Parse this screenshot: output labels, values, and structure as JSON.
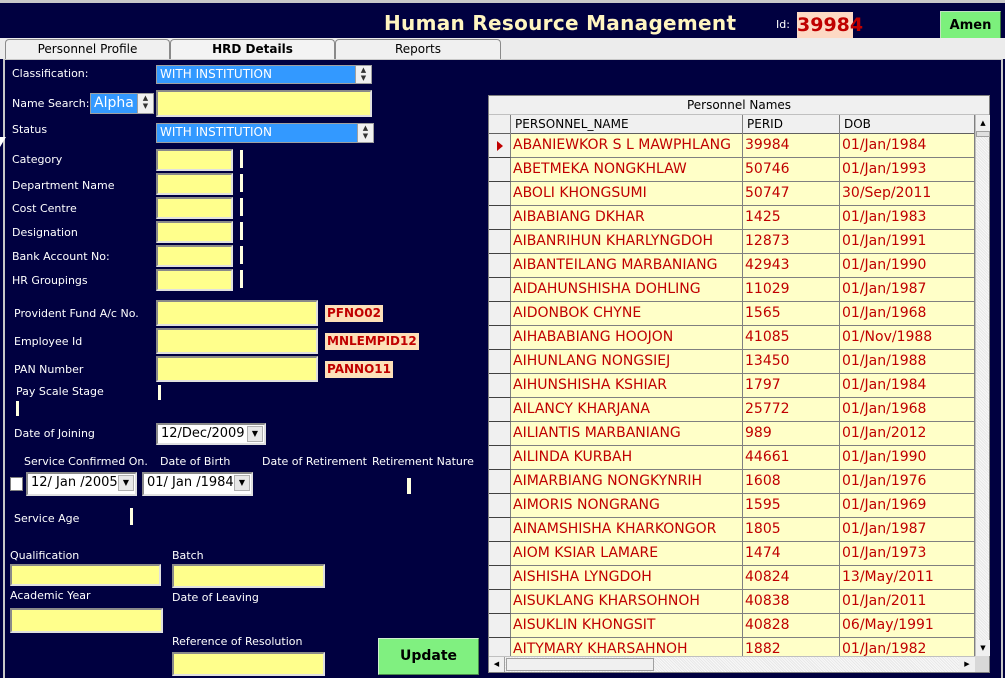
{
  "header": {
    "title": "Human Resource Management",
    "id_label": "Id:",
    "id_value": "39984",
    "user_button": "Amen"
  },
  "tabs": [
    {
      "label": "Personnel Profile",
      "active": false
    },
    {
      "label": "HRD Details",
      "active": true
    },
    {
      "label": "Reports",
      "active": false
    }
  ],
  "form": {
    "classification_label": "Classification:",
    "classification_value": "WITH INSTITUTION",
    "name_search_label": "Name Search:",
    "name_search_mode": "Alpha",
    "name_search_value": "",
    "status_label": "Status",
    "status_value": "WITH INSTITUTION",
    "category_label": "Category",
    "department_label": "Department Name",
    "cost_centre_label": "Cost Centre",
    "designation_label": "Designation",
    "bank_account_label": "Bank Account No:",
    "hr_groupings_label": "HR Groupings",
    "pf_label": "Provident Fund A/c No.",
    "pf_code": "PFNO02",
    "employee_id_label": "Employee Id",
    "employee_id_code": "MNLEMPID12",
    "pan_label": "PAN Number",
    "pan_code": "PANNO11",
    "pay_scale_label": "Pay Scale Stage",
    "doj_label": "Date of Joining",
    "doj_value": "12/Dec/2009",
    "service_confirmed_label": "Service Confirmed On.",
    "service_confirmed_value": "12/ Jan /2005",
    "dob_label": "Date of Birth",
    "dob_value": "01/ Jan /1984",
    "retirement_date_label": "Date of Retirement",
    "retirement_nature_label": "Retirement Nature",
    "service_age_label": "Service Age",
    "qualification_label": "Qualification",
    "batch_label": "Batch",
    "academic_year_label": "Academic Year",
    "date_of_leaving_label": "Date of Leaving",
    "reference_label": "Reference of Resolution",
    "update_button": "Update"
  },
  "grid": {
    "caption": "Personnel Names",
    "columns": [
      "PERSONNEL_NAME",
      "PERID",
      "DOB"
    ],
    "rows": [
      {
        "name": "ABANIEWKOR S L MAWPHLANG",
        "perid": "39984",
        "dob": "01/Jan/1984",
        "current": true
      },
      {
        "name": "ABETMEKA NONGKHLAW",
        "perid": "50746",
        "dob": "01/Jan/1993"
      },
      {
        "name": "ABOLI KHONGSUMI",
        "perid": "50747",
        "dob": "30/Sep/2011"
      },
      {
        "name": "AIBABIANG DKHAR",
        "perid": "1425",
        "dob": "01/Jan/1983"
      },
      {
        "name": "AIBANRIHUN KHARLYNGDOH",
        "perid": "12873",
        "dob": "01/Jan/1991"
      },
      {
        "name": "AIBANTEILANG MARBANIANG",
        "perid": "42943",
        "dob": "01/Jan/1990"
      },
      {
        "name": "AIDAHUNSHISHA DOHLING",
        "perid": "11029",
        "dob": "01/Jan/1987"
      },
      {
        "name": "AIDONBOK CHYNE",
        "perid": "1565",
        "dob": "01/Jan/1968"
      },
      {
        "name": "AIHABABIANG HOOJON",
        "perid": "41085",
        "dob": "01/Nov/1988"
      },
      {
        "name": "AIHUNLANG NONGSIEJ",
        "perid": "13450",
        "dob": "01/Jan/1988"
      },
      {
        "name": "AIHUNSHISHA KSHIAR",
        "perid": "1797",
        "dob": "01/Jan/1984"
      },
      {
        "name": "AILANCY KHARJANA",
        "perid": "25772",
        "dob": "01/Jan/1968"
      },
      {
        "name": "AILIANTIS MARBANIANG",
        "perid": "989",
        "dob": "01/Jan/2012"
      },
      {
        "name": "AILINDA KURBAH",
        "perid": "44661",
        "dob": "01/Jan/1990"
      },
      {
        "name": "AIMARBIANG NONGKYNRIH",
        "perid": "1608",
        "dob": "01/Jan/1976"
      },
      {
        "name": "AIMORIS NONGRANG",
        "perid": "1595",
        "dob": "01/Jan/1969"
      },
      {
        "name": "AINAMSHISHA KHARKONGOR",
        "perid": "1805",
        "dob": "01/Jan/1987"
      },
      {
        "name": "AIOM KSIAR LAMARE",
        "perid": "1474",
        "dob": "01/Jan/1973"
      },
      {
        "name": "AISHISHA LYNGDOH",
        "perid": "40824",
        "dob": "13/May/2011"
      },
      {
        "name": "AISUKLANG KHARSOHNOH",
        "perid": "40838",
        "dob": "01/Jan/2011"
      },
      {
        "name": "AISUKLIN KHONGSIT",
        "perid": "40828",
        "dob": "06/May/1991"
      },
      {
        "name": "AITYMARY KHARSAHNOH",
        "perid": "1882",
        "dob": "01/Jan/1982"
      }
    ]
  }
}
